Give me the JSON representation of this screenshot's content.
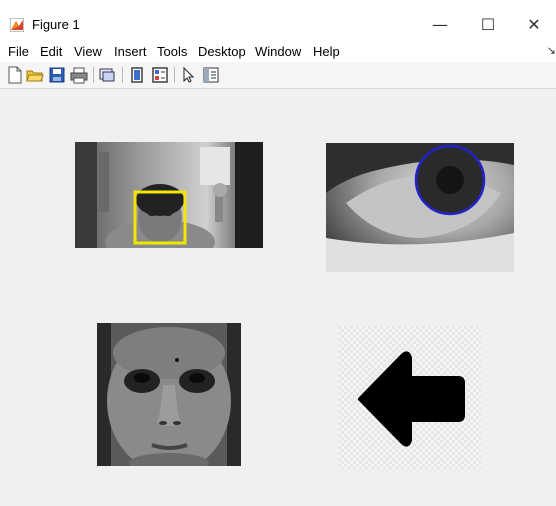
{
  "window": {
    "title": "Figure 1",
    "minimize": "—",
    "maximize": "☐",
    "close": "✕"
  },
  "menu": {
    "items": [
      "File",
      "Edit",
      "View",
      "Insert",
      "Tools",
      "Desktop",
      "Window",
      "Help"
    ],
    "extra": "↘"
  },
  "toolbar": {
    "icons": [
      "new-figure-icon",
      "open-file-icon",
      "save-icon",
      "print-icon",
      "link-plot-icon",
      "hide-plot-tools-icon",
      "show-plot-tools-icon",
      "edit-plot-icon",
      "open-property-inspector-icon"
    ]
  },
  "colors": {
    "face_box": "#f2e600",
    "iris_circle": "#2222cc"
  }
}
